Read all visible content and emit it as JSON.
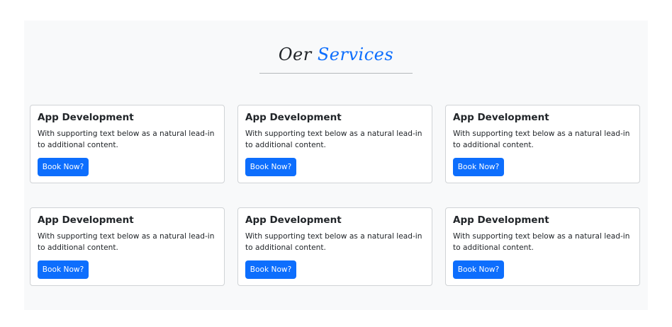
{
  "heading": {
    "prefix": "Oer",
    "accent": "Services"
  },
  "cards": [
    {
      "title": "App Development",
      "text": "With supporting text below as a natural lead-in to additional content.",
      "button": "Book Now?"
    },
    {
      "title": "App Development",
      "text": "With supporting text below as a natural lead-in to additional content.",
      "button": "Book Now?"
    },
    {
      "title": "App Development",
      "text": "With supporting text below as a natural lead-in to additional content.",
      "button": "Book Now?"
    },
    {
      "title": "App Development",
      "text": "With supporting text below as a natural lead-in to additional content.",
      "button": "Book Now?"
    },
    {
      "title": "App Development",
      "text": "With supporting text below as a natural lead-in to additional content.",
      "button": "Book Now?"
    },
    {
      "title": "App Development",
      "text": "With supporting text below as a natural lead-in to additional content.",
      "button": "Book Now?"
    }
  ],
  "colors": {
    "accent": "#0d6efd",
    "section_background": "#f8f9fa",
    "text": "#212529"
  }
}
